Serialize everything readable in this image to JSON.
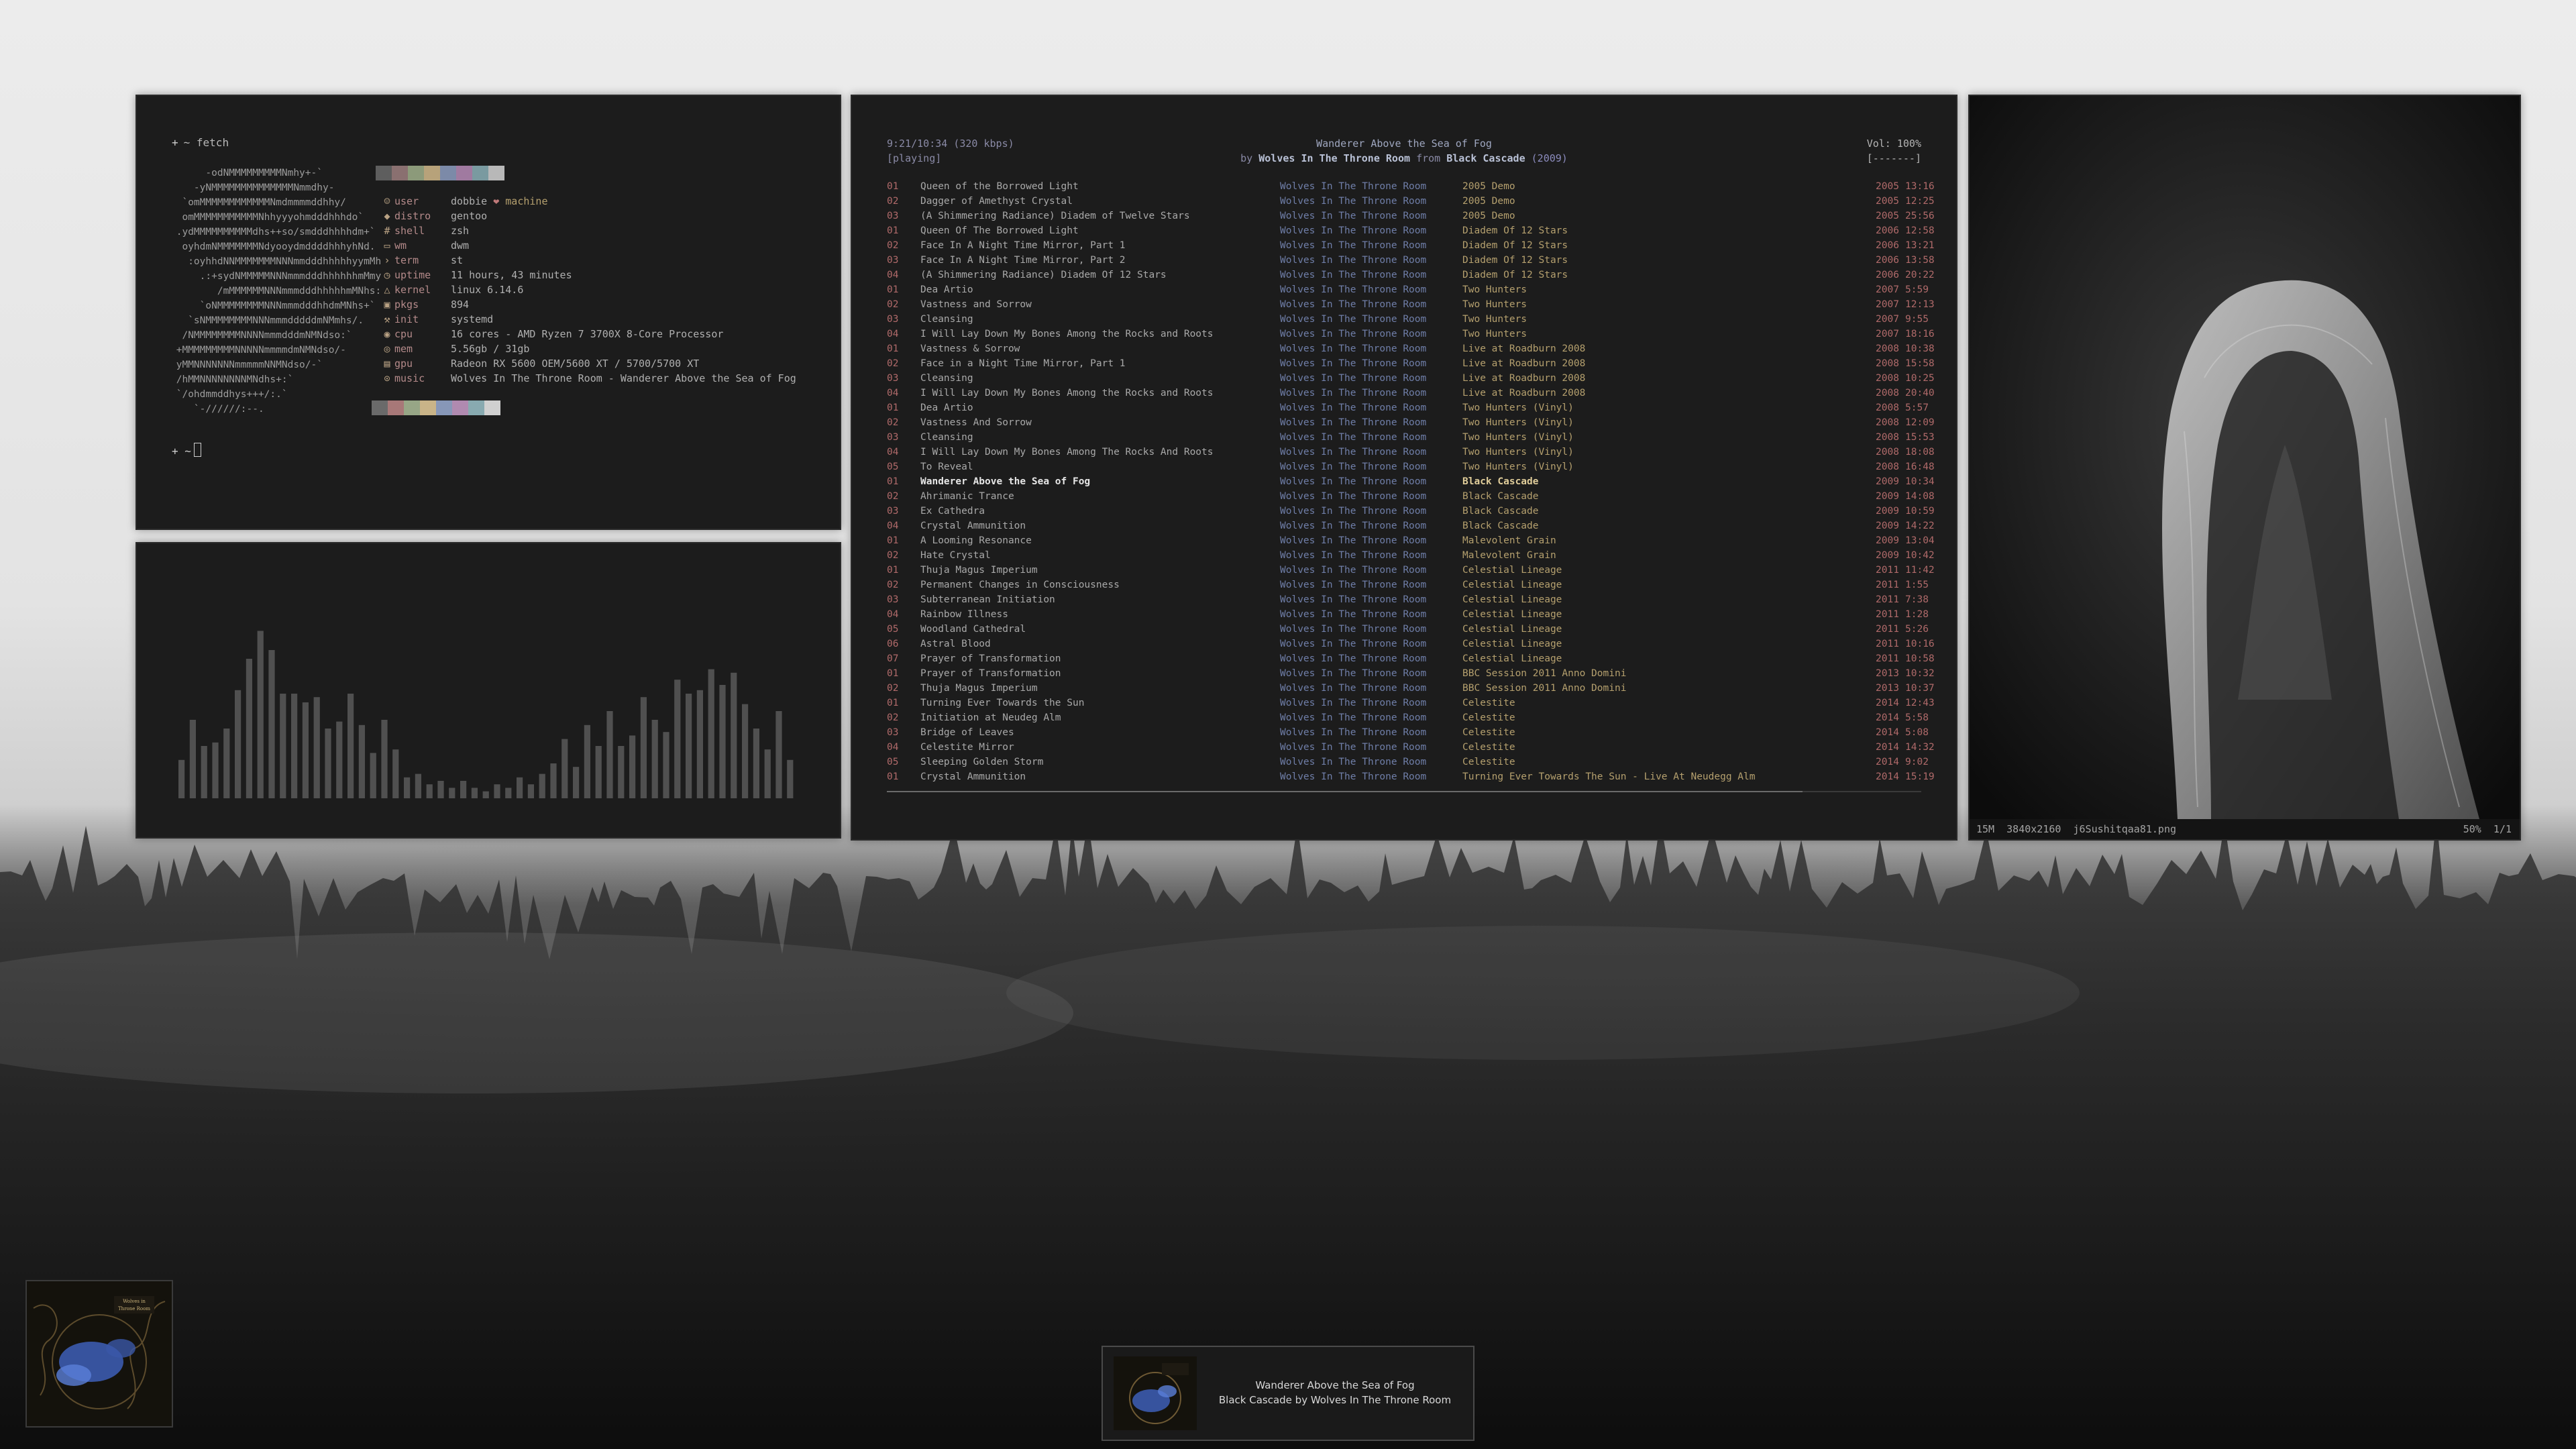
{
  "fetch": {
    "prompt_symbol": "+",
    "command": "~ fetch",
    "ascii_art": "      -odNMMMMMMMMMNmhy+-`\n    -yNMMMMMMMMMMMMMMNmmdhy-\n  `omMMMMMMMMMMMMNmdmmmmddhhy/\n  omMMMMMMMMMMMNhhyyyohmdddhhhdo`\n .ydMMMMMMMMMMdhs++so/smdddhhhhdm+`\n  oyhdmNMMMMMMMNdyooydmddddhhhyhNd.\n   :oyhhdNNMMMMMMMNNNmmdddhhhhhyymMh\n     .:+sydNMMMMMNNNmmmdddhhhhhhmMmy\n        /mMMMMMMNNNmmmdddhhhhhmMNhs:\n     `oNMMMMMMMMNNNmmmdddhhdmMNhs+`\n   `sNMMMMMMMMNNNmmmdddddmNMmhs/.\n  /NMMMMMMMMNNNNmmmdddmNMNdso:`\n +MMMMMMMMMNNNNNmmmmdmNMNdso/-\n yMMNNNNNNNmmmmmNNMNdso/-`\n /hMMNNNNNNNNMNdhs+:`\n `/ohdmmddhys+++/:.`\n    `-//////:--.",
    "user": "dobbie",
    "heart": "❤",
    "machine": "machine",
    "labels": {
      "user": "user",
      "distro": "distro",
      "shell": "shell",
      "wm": "wm",
      "term": "term",
      "uptime": "uptime",
      "kernel": "kernel",
      "pkgs": "pkgs",
      "init": "init",
      "cpu": "cpu",
      "mem": "mem",
      "gpu": "gpu",
      "music": "music"
    },
    "values": {
      "distro": "gentoo",
      "shell": "zsh",
      "wm": "dwm",
      "term": "st",
      "uptime": "11 hours, 43 minutes",
      "kernel": "linux 6.14.6",
      "pkgs": "894",
      "init": "systemd",
      "cpu": "16 cores - AMD Ryzen 7 3700X 8-Core Processor",
      "mem": "5.56gb / 31gb",
      "gpu": "Radeon RX 5600 OEM/5600 XT / 5700/5700 XT",
      "music": "Wolves In The Throne Room - Wanderer Above the Sea of Fog"
    },
    "icons": {
      "user": "user-icon",
      "distro": "distro-icon",
      "shell": "shell-icon",
      "wm": "wm-icon",
      "term": "terminal-icon",
      "uptime": "clock-icon",
      "kernel": "kernel-icon",
      "pkgs": "package-icon",
      "init": "init-icon",
      "cpu": "cpu-icon",
      "mem": "memory-icon",
      "gpu": "gpu-icon",
      "music": "music-icon"
    },
    "palette_top": [
      "#5e5e5e",
      "#8a7070",
      "#8c9a7a",
      "#b7a27a",
      "#7c8aa8",
      "#a07aa0",
      "#7a9aa0",
      "#b8b8b8"
    ],
    "palette_bottom": [
      "#6a6a6a",
      "#a87878",
      "#97a686",
      "#c9b488",
      "#8797b8",
      "#b08ab0",
      "#88aab0",
      "#d0d0d0"
    ],
    "prompt2": "~",
    "colors": {
      "accent_key": "#b48a8a",
      "icon": "#b9a284"
    }
  },
  "visualizer": {
    "levels": [
      0.22,
      0.45,
      0.3,
      0.32,
      0.4,
      0.62,
      0.8,
      0.96,
      0.85,
      0.6,
      0.6,
      0.55,
      0.58,
      0.4,
      0.44,
      0.6,
      0.42,
      0.26,
      0.45,
      0.28,
      0.12,
      0.14,
      0.08,
      0.1,
      0.06,
      0.1,
      0.06,
      0.04,
      0.08,
      0.06,
      0.12,
      0.08,
      0.14,
      0.2,
      0.34,
      0.18,
      0.42,
      0.3,
      0.5,
      0.3,
      0.36,
      0.58,
      0.45,
      0.38,
      0.68,
      0.6,
      0.62,
      0.74,
      0.65,
      0.72,
      0.54,
      0.4,
      0.28,
      0.5,
      0.22
    ]
  },
  "player": {
    "time": "9:21/10:34 (320 kbps)",
    "state": "[playing]",
    "now_title": "Wanderer Above the Sea of Fog",
    "by_word": "by",
    "now_artist": "Wolves In The Throne Room",
    "from_word": "from",
    "now_album": "Black Cascade",
    "now_year": "(2009)",
    "volume": "Vol: 100%",
    "volume_bar": "[-------]",
    "progress": 0.885,
    "tracks": [
      {
        "n": "01",
        "title": "Queen of the Borrowed Light",
        "artist": "Wolves In The Throne Room",
        "album": "2005 Demo",
        "year": "2005",
        "time": "13:16"
      },
      {
        "n": "02",
        "title": "Dagger of Amethyst Crystal",
        "artist": "Wolves In The Throne Room",
        "album": "2005 Demo",
        "year": "2005",
        "time": "12:25"
      },
      {
        "n": "03",
        "title": "(A Shimmering Radiance) Diadem of Twelve Stars",
        "artist": "Wolves In The Throne Room",
        "album": "2005 Demo",
        "year": "2005",
        "time": "25:56"
      },
      {
        "n": "01",
        "title": "Queen Of The Borrowed Light",
        "artist": "Wolves In The Throne Room",
        "album": "Diadem Of 12 Stars",
        "year": "2006",
        "time": "12:58"
      },
      {
        "n": "02",
        "title": "Face In A Night Time Mirror, Part 1",
        "artist": "Wolves In The Throne Room",
        "album": "Diadem Of 12 Stars",
        "year": "2006",
        "time": "13:21"
      },
      {
        "n": "03",
        "title": "Face In A Night Time Mirror, Part 2",
        "artist": "Wolves In The Throne Room",
        "album": "Diadem Of 12 Stars",
        "year": "2006",
        "time": "13:58"
      },
      {
        "n": "04",
        "title": "(A Shimmering Radiance) Diadem Of 12 Stars",
        "artist": "Wolves In The Throne Room",
        "album": "Diadem Of 12 Stars",
        "year": "2006",
        "time": "20:22"
      },
      {
        "n": "01",
        "title": "Dea Artio",
        "artist": "Wolves In The Throne Room",
        "album": "Two Hunters",
        "year": "2007",
        "time": "5:59"
      },
      {
        "n": "02",
        "title": "Vastness and Sorrow",
        "artist": "Wolves In The Throne Room",
        "album": "Two Hunters",
        "year": "2007",
        "time": "12:13"
      },
      {
        "n": "03",
        "title": "Cleansing",
        "artist": "Wolves In The Throne Room",
        "album": "Two Hunters",
        "year": "2007",
        "time": "9:55"
      },
      {
        "n": "04",
        "title": "I Will Lay Down My Bones Among the Rocks and Roots",
        "artist": "Wolves In The Throne Room",
        "album": "Two Hunters",
        "year": "2007",
        "time": "18:16"
      },
      {
        "n": "01",
        "title": "Vastness & Sorrow",
        "artist": "Wolves In The Throne Room",
        "album": "Live at Roadburn 2008",
        "year": "2008",
        "time": "10:38"
      },
      {
        "n": "02",
        "title": "Face in a Night Time Mirror, Part 1",
        "artist": "Wolves In The Throne Room",
        "album": "Live at Roadburn 2008",
        "year": "2008",
        "time": "15:58"
      },
      {
        "n": "03",
        "title": "Cleansing",
        "artist": "Wolves In The Throne Room",
        "album": "Live at Roadburn 2008",
        "year": "2008",
        "time": "10:25"
      },
      {
        "n": "04",
        "title": "I Will Lay Down My Bones Among the Rocks and Roots",
        "artist": "Wolves In The Throne Room",
        "album": "Live at Roadburn 2008",
        "year": "2008",
        "time": "20:40"
      },
      {
        "n": "01",
        "title": "Dea Artio",
        "artist": "Wolves In The Throne Room",
        "album": "Two Hunters (Vinyl)",
        "year": "2008",
        "time": "5:57"
      },
      {
        "n": "02",
        "title": "Vastness And Sorrow",
        "artist": "Wolves In The Throne Room",
        "album": "Two Hunters (Vinyl)",
        "year": "2008",
        "time": "12:09"
      },
      {
        "n": "03",
        "title": "Cleansing",
        "artist": "Wolves In The Throne Room",
        "album": "Two Hunters (Vinyl)",
        "year": "2008",
        "time": "15:53"
      },
      {
        "n": "04",
        "title": "I Will Lay Down My Bones Among The Rocks And Roots",
        "artist": "Wolves In The Throne Room",
        "album": "Two Hunters (Vinyl)",
        "year": "2008",
        "time": "18:08"
      },
      {
        "n": "05",
        "title": "To Reveal",
        "artist": "Wolves In The Throne Room",
        "album": "Two Hunters (Vinyl)",
        "year": "2008",
        "time": "16:48"
      },
      {
        "n": "01",
        "title": "Wanderer Above the Sea of Fog",
        "artist": "Wolves In The Throne Room",
        "album": "Black Cascade",
        "year": "2009",
        "time": "10:34",
        "current": true
      },
      {
        "n": "02",
        "title": "Ahrimanic Trance",
        "artist": "Wolves In The Throne Room",
        "album": "Black Cascade",
        "year": "2009",
        "time": "14:08"
      },
      {
        "n": "03",
        "title": "Ex Cathedra",
        "artist": "Wolves In The Throne Room",
        "album": "Black Cascade",
        "year": "2009",
        "time": "10:59"
      },
      {
        "n": "04",
        "title": "Crystal Ammunition",
        "artist": "Wolves In The Throne Room",
        "album": "Black Cascade",
        "year": "2009",
        "time": "14:22"
      },
      {
        "n": "01",
        "title": "A Looming Resonance",
        "artist": "Wolves In The Throne Room",
        "album": "Malevolent Grain",
        "year": "2009",
        "time": "13:04"
      },
      {
        "n": "02",
        "title": "Hate Crystal",
        "artist": "Wolves In The Throne Room",
        "album": "Malevolent Grain",
        "year": "2009",
        "time": "10:42"
      },
      {
        "n": "01",
        "title": "Thuja Magus Imperium",
        "artist": "Wolves In The Throne Room",
        "album": "Celestial Lineage",
        "year": "2011",
        "time": "11:42"
      },
      {
        "n": "02",
        "title": "Permanent Changes in Consciousness",
        "artist": "Wolves In The Throne Room",
        "album": "Celestial Lineage",
        "year": "2011",
        "time": "1:55"
      },
      {
        "n": "03",
        "title": "Subterranean Initiation",
        "artist": "Wolves In The Throne Room",
        "album": "Celestial Lineage",
        "year": "2011",
        "time": "7:38"
      },
      {
        "n": "04",
        "title": "Rainbow Illness",
        "artist": "Wolves In The Throne Room",
        "album": "Celestial Lineage",
        "year": "2011",
        "time": "1:28"
      },
      {
        "n": "05",
        "title": "Woodland Cathedral",
        "artist": "Wolves In The Throne Room",
        "album": "Celestial Lineage",
        "year": "2011",
        "time": "5:26"
      },
      {
        "n": "06",
        "title": "Astral Blood",
        "artist": "Wolves In The Throne Room",
        "album": "Celestial Lineage",
        "year": "2011",
        "time": "10:16"
      },
      {
        "n": "07",
        "title": "Prayer of Transformation",
        "artist": "Wolves In The Throne Room",
        "album": "Celestial Lineage",
        "year": "2011",
        "time": "10:58"
      },
      {
        "n": "01",
        "title": "Prayer of Transformation",
        "artist": "Wolves In The Throne Room",
        "album": "BBC Session 2011 Anno Domini",
        "year": "2013",
        "time": "10:32"
      },
      {
        "n": "02",
        "title": "Thuja Magus Imperium",
        "artist": "Wolves In The Throne Room",
        "album": "BBC Session 2011 Anno Domini",
        "year": "2013",
        "time": "10:37"
      },
      {
        "n": "01",
        "title": "Turning Ever Towards the Sun",
        "artist": "Wolves In The Throne Room",
        "album": "Celestite",
        "year": "2014",
        "time": "12:43"
      },
      {
        "n": "02",
        "title": "Initiation at Neudeg Alm",
        "artist": "Wolves In The Throne Room",
        "album": "Celestite",
        "year": "2014",
        "time": "5:58"
      },
      {
        "n": "03",
        "title": "Bridge of Leaves",
        "artist": "Wolves In The Throne Room",
        "album": "Celestite",
        "year": "2014",
        "time": "5:08"
      },
      {
        "n": "04",
        "title": "Celestite Mirror",
        "artist": "Wolves In The Throne Room",
        "album": "Celestite",
        "year": "2014",
        "time": "14:32"
      },
      {
        "n": "05",
        "title": "Sleeping Golden Storm",
        "artist": "Wolves In The Throne Room",
        "album": "Celestite",
        "year": "2014",
        "time": "9:02"
      },
      {
        "n": "01",
        "title": "Crystal Ammunition",
        "artist": "Wolves In The Throne Room",
        "album": "Turning Ever Towards The Sun - Live At Neudegg Alm",
        "year": "2014",
        "time": "15:19"
      }
    ],
    "colors": {
      "number": "#b06a6a",
      "artist": "#6f7ea8",
      "album": "#b5a06e"
    }
  },
  "viewer": {
    "size": "15M",
    "resolution": "3840x2160",
    "filename": "j6Sushitqaa81.png",
    "zoom": "50%",
    "index": "1/1"
  },
  "notification": {
    "title": "Wanderer Above the Sea of Fog",
    "subtitle": "Black Cascade by Wolves In The Throne Room"
  }
}
